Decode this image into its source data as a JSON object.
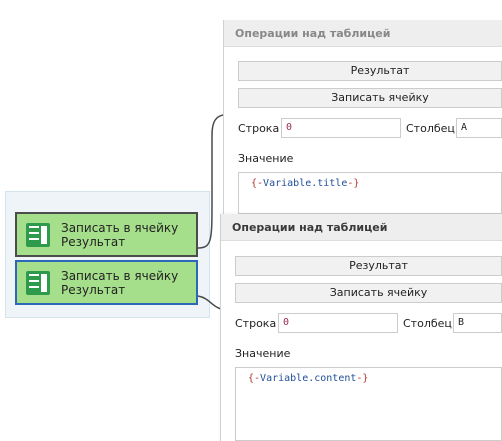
{
  "canvas": {
    "nodes": [
      {
        "line1": "Записать в ячейку",
        "line2": "Результат",
        "icon": "table-icon"
      },
      {
        "line1": "Записать в ячейку",
        "line2": "Результат",
        "icon": "table-icon"
      }
    ]
  },
  "panels": [
    {
      "title": "Операции над таблицей",
      "table_button": "Результат",
      "action_button": "Записать ячейку",
      "row_label": "Строка",
      "row_value": "0",
      "col_label": "Столбец",
      "col_value": "A",
      "value_label": "Значение",
      "value_open": "{-",
      "value_var": "Variable.title",
      "value_close": "-}"
    },
    {
      "title": "Операции над таблицей",
      "table_button": "Результат",
      "action_button": "Записать ячейку",
      "row_label": "Строка",
      "row_value": "0",
      "col_label": "Столбец",
      "col_value": "B",
      "value_label": "Значение",
      "value_open": "{-",
      "value_var": "Variable.content",
      "value_close": "-}"
    }
  ],
  "colors": {
    "node_fill": "#a6df8b",
    "node_selected_border": "#2d67b7",
    "variable_text": "#1f4f99",
    "brace_text": "#b3352f"
  }
}
